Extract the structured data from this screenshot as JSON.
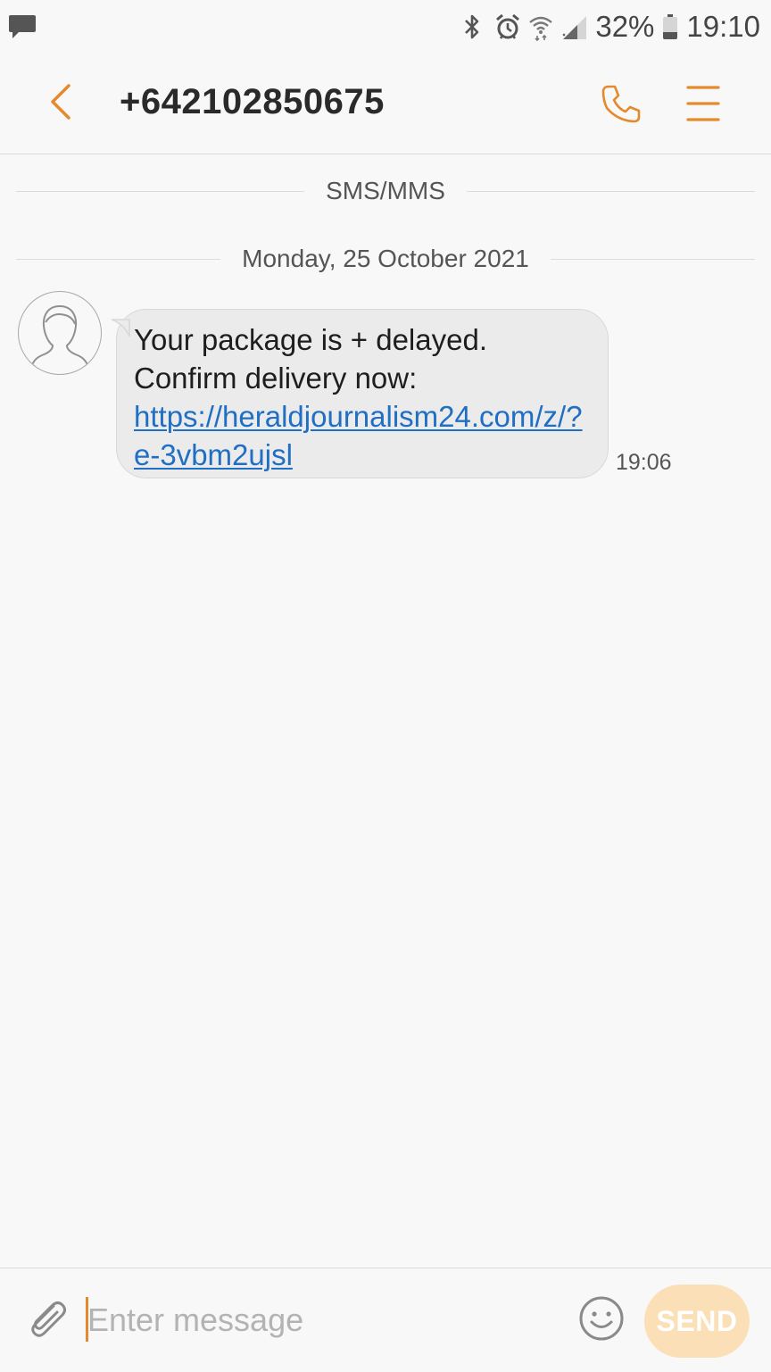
{
  "status_bar": {
    "notification_icon": "message-notification-icon",
    "icons": [
      "bluetooth-icon",
      "alarm-icon",
      "wifi-icon",
      "signal-icon"
    ],
    "battery_percent": "32%",
    "battery_level": 0.32,
    "time": "19:10"
  },
  "header": {
    "title": "+642102850675",
    "back_icon": "chevron-left-icon",
    "call_icon": "phone-icon",
    "menu_icon": "menu-icon"
  },
  "conversation": {
    "channel_label": "SMS/MMS",
    "date_label": "Monday, 25 October 2021",
    "messages": [
      {
        "line1": "Your package is + delayed.",
        "line2": "Confirm delivery now:",
        "link": "https://heraldjournalism24.com/z/?e-3vbm2ujsl",
        "time": "19:06"
      }
    ]
  },
  "composer": {
    "placeholder": "Enter message",
    "send_label": "SEND",
    "attach_icon": "paperclip-icon",
    "emoji_icon": "emoji-icon"
  },
  "colors": {
    "accent": "#e58a2c",
    "link": "#1f6fc4",
    "bubble": "#ebebeb",
    "send_disabled": "#fbdfb6"
  }
}
